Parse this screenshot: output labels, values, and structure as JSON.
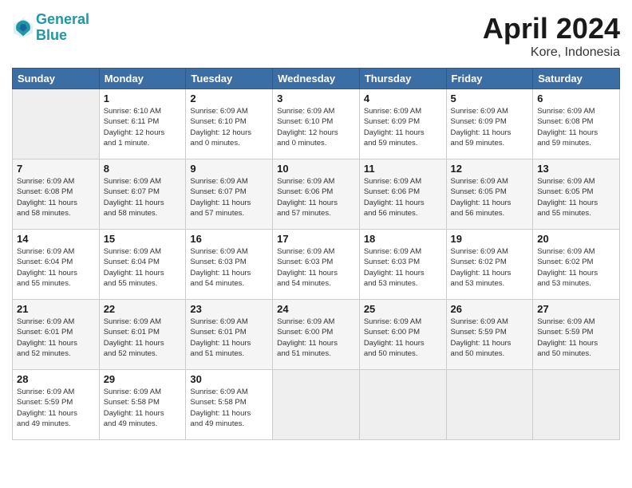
{
  "header": {
    "logo_line1": "General",
    "logo_line2": "Blue",
    "month": "April 2024",
    "location": "Kore, Indonesia"
  },
  "days_of_week": [
    "Sunday",
    "Monday",
    "Tuesday",
    "Wednesday",
    "Thursday",
    "Friday",
    "Saturday"
  ],
  "weeks": [
    [
      {
        "day": "",
        "info": ""
      },
      {
        "day": "1",
        "info": "Sunrise: 6:10 AM\nSunset: 6:11 PM\nDaylight: 12 hours\nand 1 minute."
      },
      {
        "day": "2",
        "info": "Sunrise: 6:09 AM\nSunset: 6:10 PM\nDaylight: 12 hours\nand 0 minutes."
      },
      {
        "day": "3",
        "info": "Sunrise: 6:09 AM\nSunset: 6:10 PM\nDaylight: 12 hours\nand 0 minutes."
      },
      {
        "day": "4",
        "info": "Sunrise: 6:09 AM\nSunset: 6:09 PM\nDaylight: 11 hours\nand 59 minutes."
      },
      {
        "day": "5",
        "info": "Sunrise: 6:09 AM\nSunset: 6:09 PM\nDaylight: 11 hours\nand 59 minutes."
      },
      {
        "day": "6",
        "info": "Sunrise: 6:09 AM\nSunset: 6:08 PM\nDaylight: 11 hours\nand 59 minutes."
      }
    ],
    [
      {
        "day": "7",
        "info": "Sunrise: 6:09 AM\nSunset: 6:08 PM\nDaylight: 11 hours\nand 58 minutes."
      },
      {
        "day": "8",
        "info": "Sunrise: 6:09 AM\nSunset: 6:07 PM\nDaylight: 11 hours\nand 58 minutes."
      },
      {
        "day": "9",
        "info": "Sunrise: 6:09 AM\nSunset: 6:07 PM\nDaylight: 11 hours\nand 57 minutes."
      },
      {
        "day": "10",
        "info": "Sunrise: 6:09 AM\nSunset: 6:06 PM\nDaylight: 11 hours\nand 57 minutes."
      },
      {
        "day": "11",
        "info": "Sunrise: 6:09 AM\nSunset: 6:06 PM\nDaylight: 11 hours\nand 56 minutes."
      },
      {
        "day": "12",
        "info": "Sunrise: 6:09 AM\nSunset: 6:05 PM\nDaylight: 11 hours\nand 56 minutes."
      },
      {
        "day": "13",
        "info": "Sunrise: 6:09 AM\nSunset: 6:05 PM\nDaylight: 11 hours\nand 55 minutes."
      }
    ],
    [
      {
        "day": "14",
        "info": "Sunrise: 6:09 AM\nSunset: 6:04 PM\nDaylight: 11 hours\nand 55 minutes."
      },
      {
        "day": "15",
        "info": "Sunrise: 6:09 AM\nSunset: 6:04 PM\nDaylight: 11 hours\nand 55 minutes."
      },
      {
        "day": "16",
        "info": "Sunrise: 6:09 AM\nSunset: 6:03 PM\nDaylight: 11 hours\nand 54 minutes."
      },
      {
        "day": "17",
        "info": "Sunrise: 6:09 AM\nSunset: 6:03 PM\nDaylight: 11 hours\nand 54 minutes."
      },
      {
        "day": "18",
        "info": "Sunrise: 6:09 AM\nSunset: 6:03 PM\nDaylight: 11 hours\nand 53 minutes."
      },
      {
        "day": "19",
        "info": "Sunrise: 6:09 AM\nSunset: 6:02 PM\nDaylight: 11 hours\nand 53 minutes."
      },
      {
        "day": "20",
        "info": "Sunrise: 6:09 AM\nSunset: 6:02 PM\nDaylight: 11 hours\nand 53 minutes."
      }
    ],
    [
      {
        "day": "21",
        "info": "Sunrise: 6:09 AM\nSunset: 6:01 PM\nDaylight: 11 hours\nand 52 minutes."
      },
      {
        "day": "22",
        "info": "Sunrise: 6:09 AM\nSunset: 6:01 PM\nDaylight: 11 hours\nand 52 minutes."
      },
      {
        "day": "23",
        "info": "Sunrise: 6:09 AM\nSunset: 6:01 PM\nDaylight: 11 hours\nand 51 minutes."
      },
      {
        "day": "24",
        "info": "Sunrise: 6:09 AM\nSunset: 6:00 PM\nDaylight: 11 hours\nand 51 minutes."
      },
      {
        "day": "25",
        "info": "Sunrise: 6:09 AM\nSunset: 6:00 PM\nDaylight: 11 hours\nand 50 minutes."
      },
      {
        "day": "26",
        "info": "Sunrise: 6:09 AM\nSunset: 5:59 PM\nDaylight: 11 hours\nand 50 minutes."
      },
      {
        "day": "27",
        "info": "Sunrise: 6:09 AM\nSunset: 5:59 PM\nDaylight: 11 hours\nand 50 minutes."
      }
    ],
    [
      {
        "day": "28",
        "info": "Sunrise: 6:09 AM\nSunset: 5:59 PM\nDaylight: 11 hours\nand 49 minutes."
      },
      {
        "day": "29",
        "info": "Sunrise: 6:09 AM\nSunset: 5:58 PM\nDaylight: 11 hours\nand 49 minutes."
      },
      {
        "day": "30",
        "info": "Sunrise: 6:09 AM\nSunset: 5:58 PM\nDaylight: 11 hours\nand 49 minutes."
      },
      {
        "day": "",
        "info": ""
      },
      {
        "day": "",
        "info": ""
      },
      {
        "day": "",
        "info": ""
      },
      {
        "day": "",
        "info": ""
      }
    ]
  ]
}
